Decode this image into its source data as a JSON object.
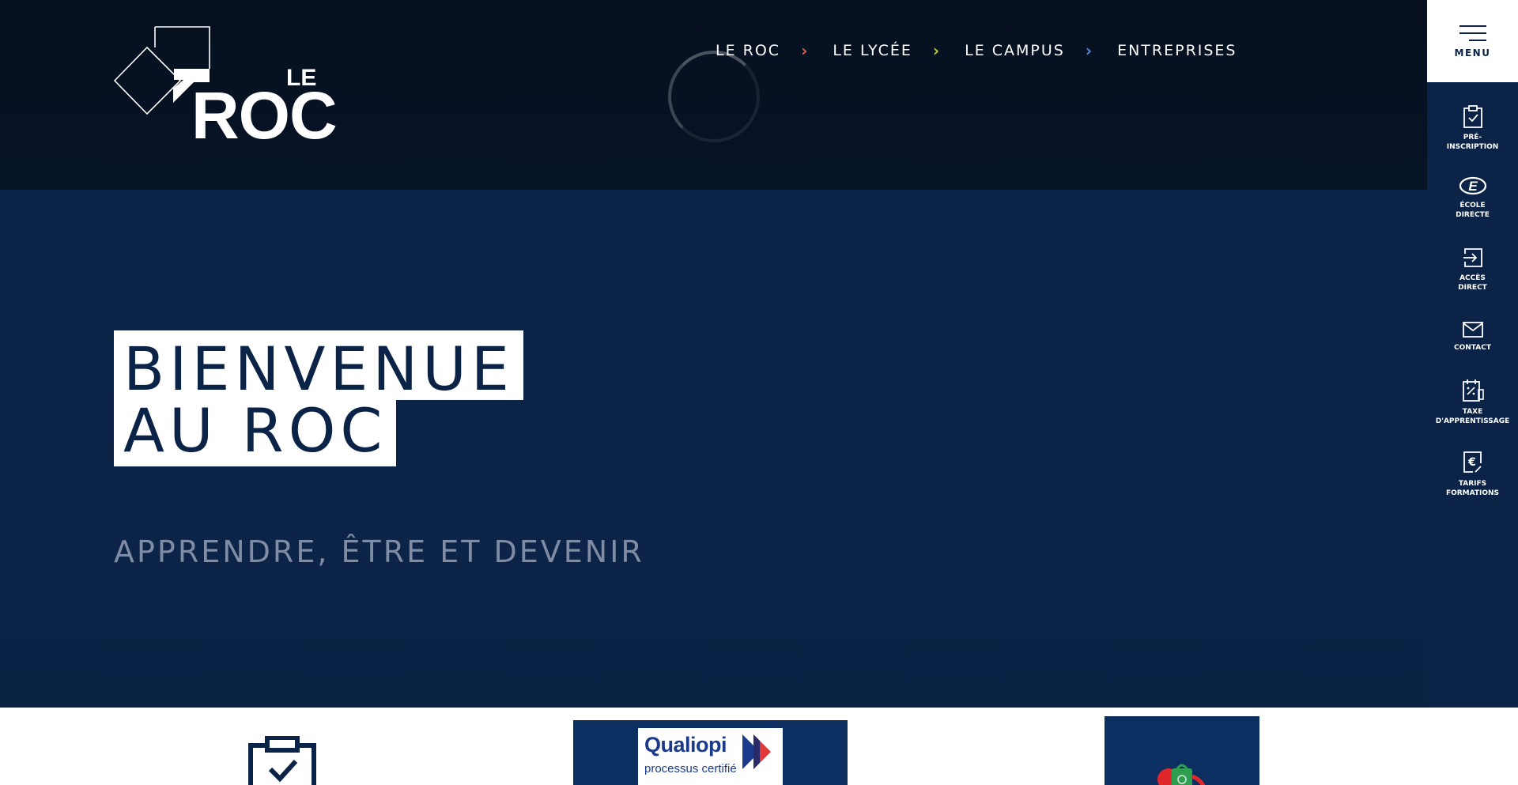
{
  "logo": {
    "le": "LE",
    "roc": "ROC"
  },
  "nav": {
    "items": [
      {
        "label": "LE ROC",
        "chevron_color": "#e05a4f"
      },
      {
        "label": "LE LYCÉE",
        "chevron_color": "#b8c93a"
      },
      {
        "label": "LE CAMPUS",
        "chevron_color": "#4a8fe0"
      },
      {
        "label": "ENTREPRISES"
      }
    ]
  },
  "hero": {
    "title_line1": "BIENVENUE",
    "title_line2": "AU ROC",
    "subtitle": "APPRENDRE, ÊTRE ET DEVENIR"
  },
  "menu": {
    "label": "MENU"
  },
  "sidebar": {
    "items": [
      {
        "label": "PRÉ-\nINSCRIPTION",
        "icon": "clipboard-check-icon"
      },
      {
        "label": "ÉCOLE\nDIRECTE",
        "icon": "ecole-directe-icon"
      },
      {
        "label": "ACCÈS\nDIRECT",
        "icon": "login-arrow-icon"
      },
      {
        "label": "CONTACT",
        "icon": "envelope-icon"
      },
      {
        "label": "TAXE\nD'APPRENTISSAGE",
        "icon": "tax-document-icon"
      },
      {
        "label": "TARIFS\nFORMATIONS",
        "icon": "euro-document-icon"
      }
    ]
  },
  "bottom": {
    "qualiopi_name": "Qualiopi",
    "qualiopi_sub": "processus certifié"
  },
  "colors": {
    "header_bg": "#06101f",
    "hero_bg": "#0a2347",
    "accent_navy": "#0a2347"
  }
}
